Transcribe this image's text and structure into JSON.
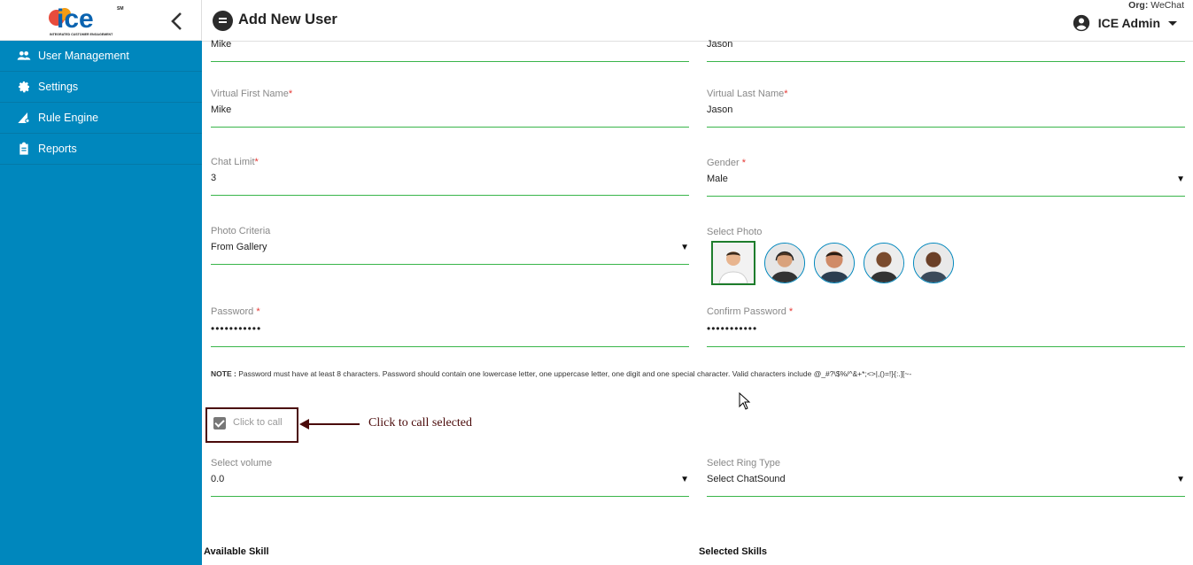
{
  "sidebar": {
    "logo_text": "ice",
    "logo_tagline": "INTEGRATED CUSTOMER ENGAGEMENT",
    "logo_mark": "SM",
    "items": [
      {
        "label": "User Management",
        "icon": "users-icon"
      },
      {
        "label": "Settings",
        "icon": "gear-icon"
      },
      {
        "label": "Rule Engine",
        "icon": "rule-engine-icon"
      },
      {
        "label": "Reports",
        "icon": "clipboard-icon"
      }
    ]
  },
  "header": {
    "title": "Add New User",
    "org_label": "Org:",
    "org_value": "WeChat",
    "user": "ICE Admin"
  },
  "form": {
    "first_name": "Mike",
    "last_name": "Jason",
    "virtual_first_name": {
      "label": "Virtual First Name",
      "value": "Mike"
    },
    "virtual_last_name": {
      "label": "Virtual Last Name",
      "value": "Jason"
    },
    "chat_limit": {
      "label": "Chat Limit",
      "value": "3"
    },
    "gender": {
      "label": "Gender",
      "value": "Male"
    },
    "photo_criteria": {
      "label": "Photo Criteria",
      "value": "From Gallery"
    },
    "select_photo": {
      "label": "Select Photo"
    },
    "password": {
      "label": "Password",
      "value": "•••••••••••"
    },
    "confirm_password": {
      "label": "Confirm Password",
      "value": "•••••••••••"
    },
    "note_label": "NOTE :",
    "note_text": "Password must have at least 8 characters. Password should contain one lowercase letter, one uppercase letter, one digit and one special character. Valid characters include @_#?\\$%/^&+*;<>|,()=!}{:.][~-",
    "click_to_call": {
      "label": "Click to call",
      "checked": true
    },
    "select_volume": {
      "label": "Select volume",
      "value": "0.0"
    },
    "ring_type": {
      "label": "Select Ring Type",
      "value": "Select ChatSound"
    },
    "available_skill": "Available Skill",
    "selected_skills": "Selected Skills"
  },
  "annotation": "Click to call selected",
  "colors": {
    "sidebar": "#0087bd",
    "underline": "#39b54a",
    "required": "#e53935",
    "annotation": "#4a0a0a"
  }
}
